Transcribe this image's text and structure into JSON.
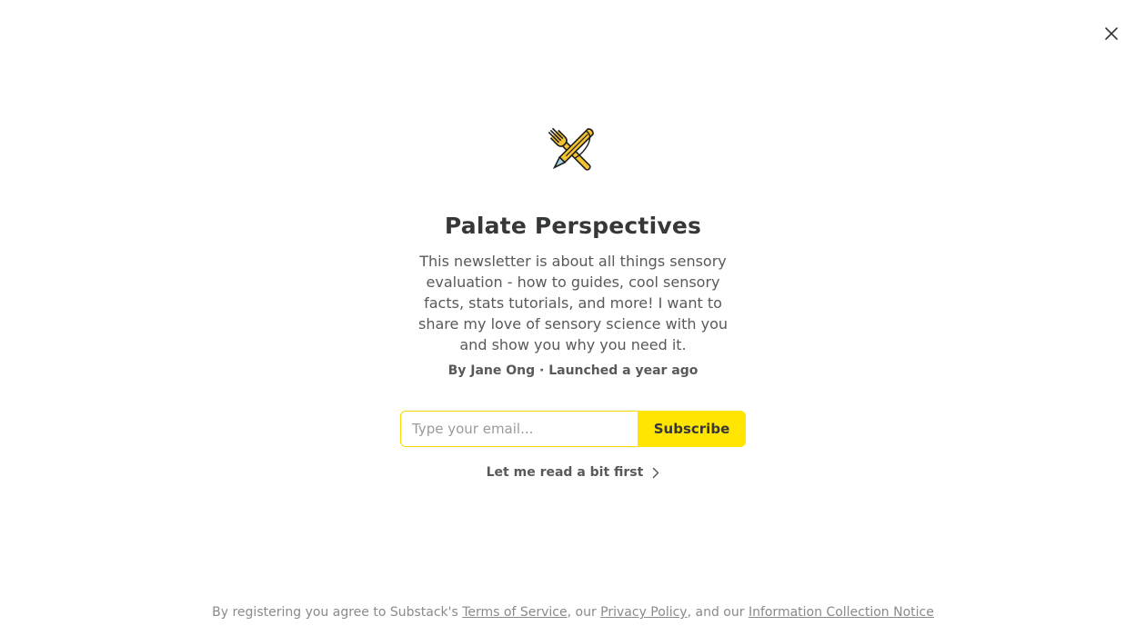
{
  "modal": {
    "close_icon": "close-icon",
    "logo_icon": "fork-and-pen-logo-icon",
    "title": "Palate Perspectives",
    "description": "This newsletter is about all things sensory evaluation - how to guides, cool sensory facts, stats tutorials, and more! I want to share my love of sensory science with you and show you why you need it.",
    "byline": "By Jane Ong · Launched a year ago",
    "email_placeholder": "Type your email...",
    "subscribe_label": "Subscribe",
    "read_first_label": "Let me read a bit first",
    "read_first_icon": "chevron-right-icon"
  },
  "footer": {
    "prefix": "By registering you agree to Substack's ",
    "terms": "Terms of Service",
    "sep1": ", our ",
    "privacy": "Privacy Policy",
    "sep2": ", and our ",
    "notice": "Information Collection Notice"
  },
  "colors": {
    "accent": "#ffe500",
    "input_border": "#f5dd00",
    "title": "#363737",
    "body": "#595959",
    "footer": "#8a8a8a"
  }
}
